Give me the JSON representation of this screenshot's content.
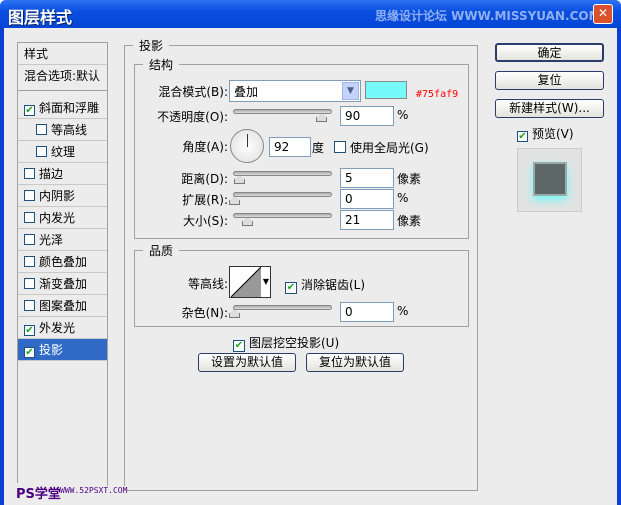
{
  "window": {
    "title": "图层样式",
    "watermark": "思缘设计论坛 WWW.MISSYUAN.COM",
    "close": "✕"
  },
  "sidebar": {
    "items": [
      {
        "label": "样式",
        "checkbox": false
      },
      {
        "label": "混合选项:默认",
        "checkbox": false
      },
      {
        "label": "斜面和浮雕",
        "checkbox": true,
        "checked": true
      },
      {
        "label": "等高线",
        "checkbox": true,
        "checked": false,
        "indent": true
      },
      {
        "label": "纹理",
        "checkbox": true,
        "checked": false,
        "indent": true
      },
      {
        "label": "描边",
        "checkbox": true,
        "checked": false
      },
      {
        "label": "内阴影",
        "checkbox": true,
        "checked": false
      },
      {
        "label": "内发光",
        "checkbox": true,
        "checked": false
      },
      {
        "label": "光泽",
        "checkbox": true,
        "checked": false
      },
      {
        "label": "颜色叠加",
        "checkbox": true,
        "checked": false
      },
      {
        "label": "渐变叠加",
        "checkbox": true,
        "checked": false
      },
      {
        "label": "图案叠加",
        "checkbox": true,
        "checked": false
      },
      {
        "label": "外发光",
        "checkbox": true,
        "checked": true
      },
      {
        "label": "投影",
        "checkbox": true,
        "checked": true,
        "selected": true
      }
    ]
  },
  "panel": {
    "title": "投影",
    "structure": {
      "title": "结构",
      "blend_label": "混合模式(B):",
      "blend_value": "叠加",
      "color": "#75faf9",
      "color_note": "#75faf9",
      "opacity_label": "不透明度(O):",
      "opacity": "90",
      "opacity_unit": "%",
      "angle_label": "角度(A):",
      "angle": "92",
      "angle_unit": "度",
      "global_light": "使用全局光(G)",
      "global_light_checked": false,
      "distance_label": "距离(D):",
      "distance": "5",
      "distance_unit": "像素",
      "spread_label": "扩展(R):",
      "spread": "0",
      "spread_unit": "%",
      "size_label": "大小(S):",
      "size": "21",
      "size_unit": "像素"
    },
    "quality": {
      "title": "品质",
      "contour_label": "等高线:",
      "antialias": "消除锯齿(L)",
      "antialias_checked": true,
      "noise_label": "杂色(N):",
      "noise": "0",
      "noise_unit": "%"
    },
    "knockout": "图层挖空投影(U)",
    "knockout_checked": true,
    "set_default": "设置为默认值",
    "reset_default": "复位为默认值"
  },
  "buttons": {
    "ok": "确定",
    "reset": "复位",
    "new_style": "新建样式(W)...",
    "preview": "预览(V)",
    "preview_checked": true
  },
  "footer": {
    "logo": "PS学堂",
    "url": "WWW.52PSXT.COM"
  }
}
